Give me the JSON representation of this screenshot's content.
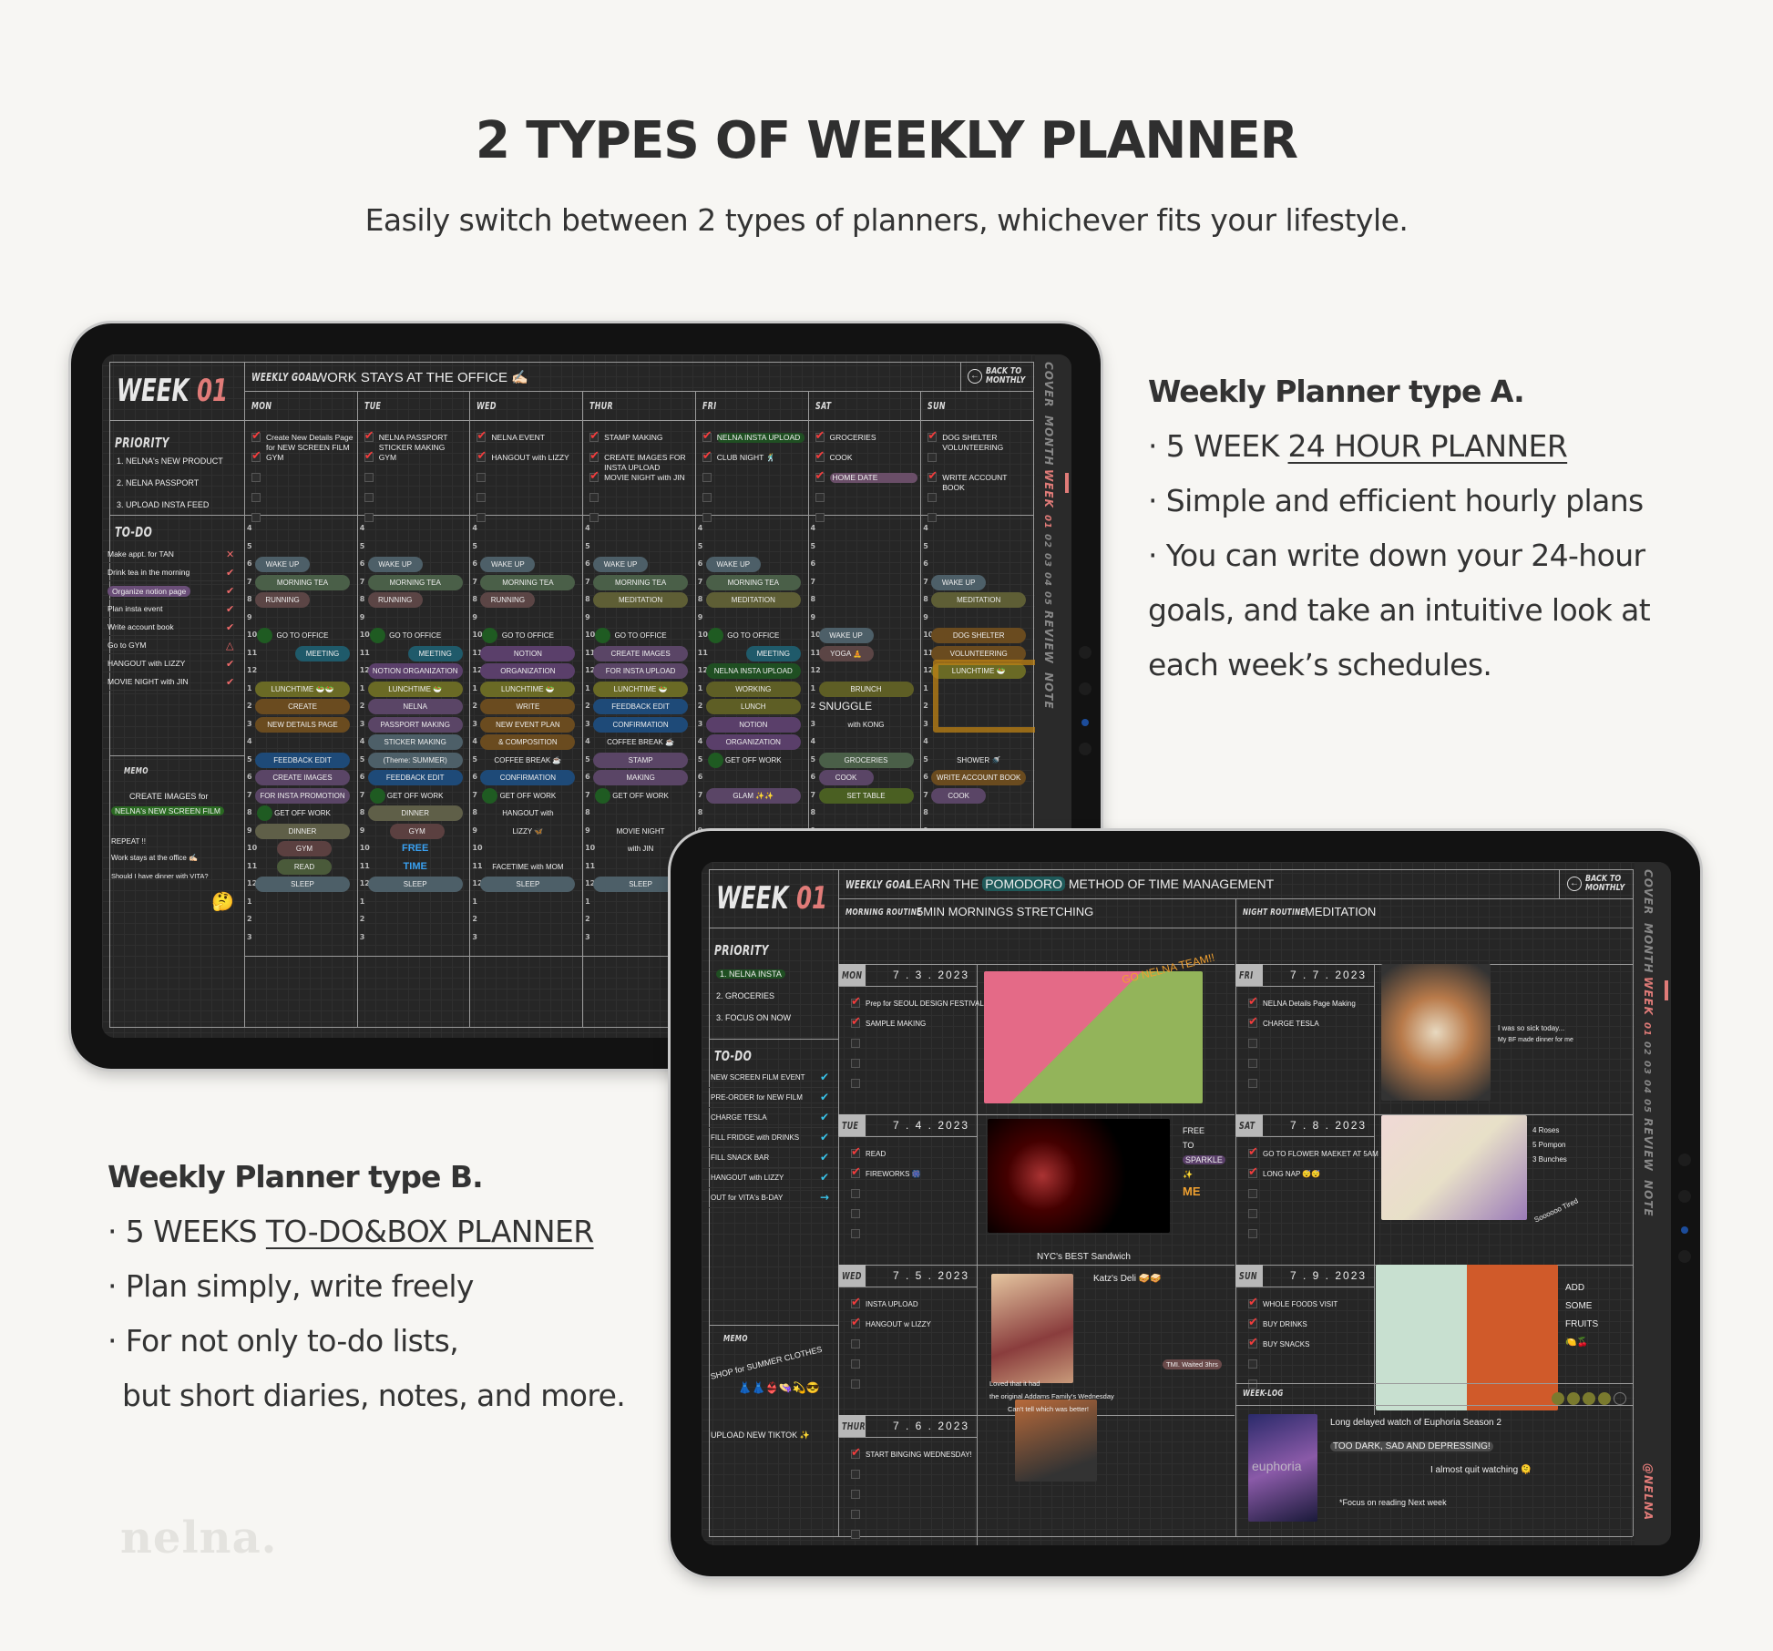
{
  "header": {
    "title": "2 TYPES OF WEEKLY PLANNER",
    "subtitle": "Easily switch between 2 types of planners, whichever fits your lifestyle."
  },
  "typeA": {
    "heading": "Weekly Planner type A.",
    "bullet1_prefix": "· 5 WEEK ",
    "bullet1_link": "24 HOUR PLANNER",
    "bullet2": "· Simple and efficient hourly plans",
    "bullet3_l1": "· You can write down your 24-hour",
    "bullet3_l2": "goals, and take an intuitive look at",
    "bullet3_l3": "each week’s schedules."
  },
  "typeB": {
    "heading": "Weekly Planner type B.",
    "bullet1_prefix": "· 5 WEEKS ",
    "bullet1_link": "TO-DO&BOX PLANNER",
    "bullet2": "· Plan simply, write freely",
    "bullet3_l1": "· For not only to-do lists,",
    "bullet3_l2": "but short diaries, notes, and more."
  },
  "brand": "nelna.",
  "colors": {
    "accent": "#e07b78",
    "background": "#f7f6f3",
    "screen": "#262626",
    "check": "#f23c3c",
    "todo_check_b": "#39c2e8"
  },
  "sidebar": {
    "items": [
      "COVER",
      "MONTH",
      "WEEK",
      "01",
      "02",
      "03",
      "04",
      "05",
      "REVIEW",
      "NOTE"
    ],
    "active": "WEEK",
    "active_week": "01",
    "handle": "@NELNA"
  },
  "back_button": {
    "line1": "BACK TO",
    "line2": "MONTHLY",
    "icon": "arrow-left-circle-icon"
  },
  "plannerA": {
    "week_label": "WEEK",
    "week_num": "01",
    "weekly_goal_label": "WEEKLY GOAL",
    "weekly_goal": "WORK STAYS AT THE OFFICE ✍🏻",
    "days": [
      "MON",
      "TUE",
      "WED",
      "THUR",
      "FRI",
      "SAT",
      "SUN"
    ],
    "priority_label": "PRIORITY",
    "priorities": [
      "1. NELNA's NEW PRODUCT",
      "2. NELNA PASSPORT",
      "3. UPLOAD INSTA FEED"
    ],
    "day_checks": [
      [
        "Create New Details Page for NEW SCREEN FILM",
        "GYM"
      ],
      [
        "NELNA PASSPORT STICKER MAKING",
        "GYM"
      ],
      [
        "NELNA EVENT",
        "HANGOUT with LIZZY"
      ],
      [
        "STAMP MAKING",
        "CREATE IMAGES FOR INSTA UPLOAD",
        "MOVIE NIGHT with JIN"
      ],
      [
        "NELNA INSTA UPLOAD",
        "CLUB NIGHT 🕺"
      ],
      [
        "GROCERIES",
        "COOK",
        "HOME DATE"
      ],
      [
        "DOG SHELTER VOLUNTEERING",
        "",
        "WRITE ACCOUNT BOOK"
      ]
    ],
    "todo_label": "TO-DO",
    "todos": [
      {
        "text": "Make appt. for TAN",
        "mark": "✕"
      },
      {
        "text": "Drink tea in the morning",
        "mark": "✔"
      },
      {
        "text": "Organize notion page",
        "mark": "✔"
      },
      {
        "text": "Plan insta event",
        "mark": "✔"
      },
      {
        "text": "Write account book",
        "mark": "✔"
      },
      {
        "text": "Go to GYM",
        "mark": "△"
      },
      {
        "text": "HANGOUT with LIZZY",
        "mark": "✔"
      },
      {
        "text": "MOVIE NIGHT with JIN",
        "mark": "✔"
      }
    ],
    "memo_label": "MEMO",
    "memo": [
      "CREATE IMAGES for",
      "NELNA's NEW SCREEN FILM",
      "REPEAT !!",
      "Work stays at the office ✍🏻",
      "Should I have dinner with VITA?",
      "🤔"
    ],
    "hours": [
      "4",
      "5",
      "6",
      "7",
      "8",
      "9",
      "10",
      "11",
      "12",
      "1",
      "2",
      "3",
      "4",
      "5",
      "6",
      "7",
      "8",
      "9",
      "10",
      "11",
      "12",
      "1",
      "2",
      "3"
    ],
    "schedule": [
      [
        [
          "6",
          "WAKE UP"
        ],
        [
          "7",
          "MORNING TEA"
        ],
        [
          "8",
          "RUNNING"
        ],
        [
          "10",
          "GO TO OFFICE"
        ],
        [
          "11",
          "MEETING"
        ],
        [
          "1",
          "LUNCHTIME 🥗🥗"
        ],
        [
          "2",
          "CREATE"
        ],
        [
          "3",
          "NEW DETAILS PAGE"
        ],
        [
          "5",
          "FEEDBACK   EDIT"
        ],
        [
          "6",
          "CREATE IMAGES"
        ],
        [
          "7",
          "FOR INSTA PROMOTION"
        ],
        [
          "8",
          "GET OFF WORK"
        ],
        [
          "9",
          "DINNER"
        ],
        [
          "10",
          "GYM"
        ],
        [
          "11",
          "READ"
        ],
        [
          "12",
          "SLEEP"
        ]
      ],
      [
        [
          "6",
          "WAKE UP"
        ],
        [
          "7",
          "MORNING TEA"
        ],
        [
          "8",
          "RUNNING"
        ],
        [
          "10",
          "GO TO OFFICE"
        ],
        [
          "11",
          "MEETING"
        ],
        [
          "12",
          "NOTION ORGANIZATION"
        ],
        [
          "1",
          "LUNCHTIME 🥗"
        ],
        [
          "2",
          "NELNA"
        ],
        [
          "3",
          "PASSPORT MAKING"
        ],
        [
          "4",
          "STICKER MAKING"
        ],
        [
          "5",
          "(Theme: SUMMER)"
        ],
        [
          "6",
          "FEEDBACK   EDIT"
        ],
        [
          "7",
          "GET OFF WORK"
        ],
        [
          "8",
          "DINNER"
        ],
        [
          "9",
          "GYM"
        ],
        [
          "10",
          "FREE"
        ],
        [
          "11",
          "TIME"
        ],
        [
          "12",
          "SLEEP"
        ]
      ],
      [
        [
          "6",
          "WAKE UP"
        ],
        [
          "7",
          "MORNING TEA"
        ],
        [
          "8",
          "RUNNING"
        ],
        [
          "10",
          "GO TO OFFICE"
        ],
        [
          "11",
          "NOTION"
        ],
        [
          "12",
          "ORGANIZATION"
        ],
        [
          "1",
          "LUNCHTIME 🥗"
        ],
        [
          "2",
          "WRITE"
        ],
        [
          "3",
          "NEW EVENT PLAN"
        ],
        [
          "4",
          "& COMPOSITION"
        ],
        [
          "5",
          "COFFEE BREAK ☕"
        ],
        [
          "6",
          "CONFIRMATION"
        ],
        [
          "7",
          "GET OFF WORK"
        ],
        [
          "8",
          "HANGOUT with"
        ],
        [
          "9",
          "LIZZY 🦋"
        ],
        [
          "11",
          "FACETIME with MOM"
        ],
        [
          "12",
          "SLEEP"
        ]
      ],
      [
        [
          "6",
          "WAKE UP"
        ],
        [
          "7",
          "MORNING TEA"
        ],
        [
          "8",
          "MEDITATION"
        ],
        [
          "10",
          "GO TO OFFICE"
        ],
        [
          "11",
          "CREATE IMAGES"
        ],
        [
          "12",
          "FOR INSTA UPLOAD"
        ],
        [
          "1",
          "LUNCHTIME 🥗"
        ],
        [
          "2",
          "FEEDBACK   EDIT"
        ],
        [
          "3",
          "CONFIRMATION"
        ],
        [
          "4",
          "COFFEE BREAK ☕"
        ],
        [
          "5",
          "STAMP"
        ],
        [
          "6",
          "MAKING"
        ],
        [
          "7",
          "GET OFF WORK"
        ],
        [
          "9",
          "MOVIE NIGHT"
        ],
        [
          "10",
          "with JIN"
        ],
        [
          "12",
          "SLEEP"
        ]
      ],
      [
        [
          "6",
          "WAKE UP"
        ],
        [
          "7",
          "MORNING TEA"
        ],
        [
          "8",
          "MEDITATION"
        ],
        [
          "10",
          "GO TO OFFICE"
        ],
        [
          "11",
          "MEETING"
        ],
        [
          "12",
          "NELNA INSTA UPLOAD"
        ],
        [
          "1",
          "WORKING"
        ],
        [
          "2",
          "LUNCH"
        ],
        [
          "3",
          "NOTION"
        ],
        [
          "4",
          "ORGANIZATION"
        ],
        [
          "5",
          "GET OFF WORK"
        ],
        [
          "7",
          "GLAM ✨✨"
        ]
      ],
      [
        [
          "10",
          "WAKE UP"
        ],
        [
          "11",
          "YOGA 🧘"
        ],
        [
          "1",
          "BRUNCH"
        ],
        [
          "2",
          "SNUGGLE"
        ],
        [
          "3",
          "with KONG"
        ],
        [
          "5",
          "GROCERIES"
        ],
        [
          "6",
          "COOK"
        ],
        [
          "7",
          "SET TABLE"
        ]
      ],
      [
        [
          "7",
          "WAKE UP"
        ],
        [
          "8",
          "MEDITATION"
        ],
        [
          "10",
          "DOG SHELTER"
        ],
        [
          "11",
          "VOLUNTEERING"
        ],
        [
          "12",
          "LUNCHTIME 🥗"
        ],
        [
          "5",
          "SHOWER 🚿"
        ],
        [
          "6",
          "WRITE ACCOUNT BOOK"
        ],
        [
          "7",
          "COOK"
        ]
      ]
    ]
  },
  "plannerB": {
    "week_label": "WEEK",
    "week_num": "01",
    "weekly_goal_label": "WEEKLY GOAL",
    "weekly_goal_pre": "LEARN THE ",
    "weekly_goal_hl": "POMODORO",
    "weekly_goal_post": " METHOD OF TIME MANAGEMENT",
    "morning_label": "MORNING ROUTINE",
    "morning": "5MIN MORNINGS STRETCHING",
    "night_label": "NIGHT ROUTINE",
    "night": "MEDITATION",
    "priority_label": "PRIORITY",
    "priorities": [
      "1. NELNA INSTA",
      "2. GROCERIES",
      "3. FOCUS ON NOW"
    ],
    "todo_label": "TO-DO",
    "todos": [
      {
        "text": "NEW SCREEN FILM EVENT",
        "mark": "✔"
      },
      {
        "text": "PRE-ORDER for NEW FILM",
        "mark": "✔"
      },
      {
        "text": "CHARGE TESLA",
        "mark": "✔"
      },
      {
        "text": "FILL FRIDGE with DRINKS",
        "mark": "✔"
      },
      {
        "text": "FILL SNACK BAR",
        "mark": "✔"
      },
      {
        "text": "HANGOUT with LIZZY",
        "mark": "✔"
      },
      {
        "text": "OUT for VITA's B-DAY",
        "mark": "→"
      }
    ],
    "memo_label": "MEMO",
    "memo": [
      "SHOP for SUMMER CLOTHES",
      "👗👗👙👒💫😎",
      "UPLOAD NEW TIKTOK ✨"
    ],
    "days": [
      {
        "day": "MON",
        "date": "7 . 3 . 2023",
        "checks": [
          "Prep for SEOUL DESIGN FESTIVAL",
          "SAMPLE MAKING"
        ],
        "notes": [
          "GO NELNA TEAM!!"
        ]
      },
      {
        "day": "TUE",
        "date": "7 . 4 . 2023",
        "checks": [
          "READ",
          "FIREWORKS 🎆"
        ],
        "notes": [
          "FREE",
          "TO",
          "SPARKLE",
          "✨",
          "ME"
        ]
      },
      {
        "day": "WED",
        "date": "7 . 5 . 2023",
        "checks": [
          "INSTA UPLOAD",
          "HANGOUT w LIZZY"
        ],
        "notes": [
          "NYC's BEST Sandwich",
          "Katz's Deli 🥪🥪",
          "TMI. Waited 3hrs"
        ]
      },
      {
        "day": "THUR",
        "date": "7 . 6 . 2023",
        "checks": [
          "START BINGING WEDNESDAY!"
        ],
        "notes": [
          "Loved that it had",
          "the original Addams Family's Wednesday",
          "Can't tell which was better!"
        ]
      },
      {
        "day": "FRI",
        "date": "7 . 7 . 2023",
        "checks": [
          "NELNA Details Page Making",
          "CHARGE TESLA"
        ],
        "notes": [
          "I was so sick today...",
          "My BF made dinner for me"
        ]
      },
      {
        "day": "SAT",
        "date": "7 . 8 . 2023",
        "checks": [
          "GO TO FLOWER MAEKET AT 5AM",
          "LONG NAP 😴😴"
        ],
        "notes": [
          "4 Roses",
          "5 Pompon",
          "3 Bunches",
          "Soooooo Tired"
        ]
      },
      {
        "day": "SUN",
        "date": "7 . 9 . 2023",
        "checks": [
          "WHOLE FOODS VISIT",
          "BUY DRINKS",
          "BUY SNACKS"
        ],
        "notes": [
          "ADD",
          "SOME",
          "FRUITS",
          "🍋🍒"
        ]
      }
    ],
    "weeklog_label": "WEEK-LOG",
    "mood_rating": 4,
    "mood_max": 5,
    "weeklog": [
      "Long delayed watch of Euphoria Season 2",
      "TOO DARK, SAD AND DEPRESSING!",
      "I almost quit watching 🫠",
      "*Focus on reading Next week"
    ],
    "poster_text": "euphoria"
  }
}
